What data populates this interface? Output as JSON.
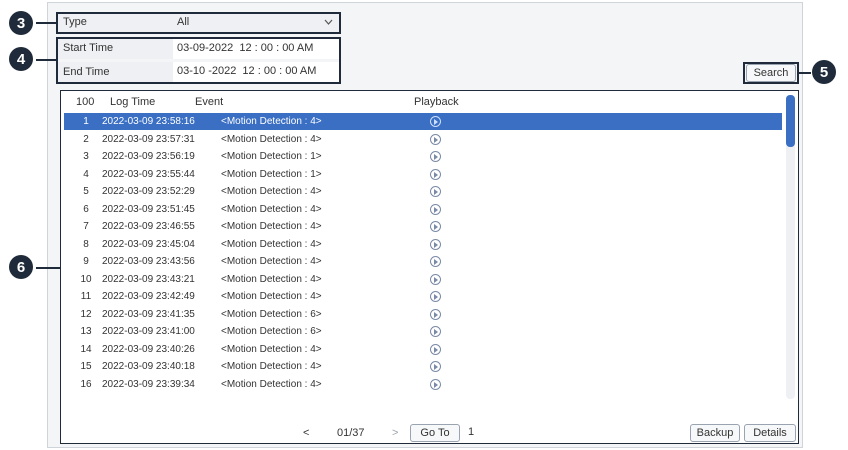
{
  "filters": {
    "type_label": "Type",
    "type_value": "All",
    "start_time_label": "Start Time",
    "start_time_value": "03-09-2022  12 : 00 : 00 AM",
    "end_time_label": "End Time",
    "end_time_value": "03-10 -2022  12 : 00 : 00 AM",
    "search_label": "Search"
  },
  "callouts": [
    "3",
    "4",
    "5",
    "6"
  ],
  "table": {
    "headers": {
      "count": "100",
      "log_time": "Log Time",
      "event": "Event",
      "playback": "Playback"
    },
    "rows": [
      {
        "num": "1",
        "time": "2022-03-09 23:58:16",
        "event": "<Motion Detection : 4>",
        "selected": true
      },
      {
        "num": "2",
        "time": "2022-03-09 23:57:31",
        "event": "<Motion Detection : 4>"
      },
      {
        "num": "3",
        "time": "2022-03-09 23:56:19",
        "event": "<Motion Detection : 1>"
      },
      {
        "num": "4",
        "time": "2022-03-09 23:55:44",
        "event": "<Motion Detection : 1>"
      },
      {
        "num": "5",
        "time": "2022-03-09 23:52:29",
        "event": "<Motion Detection : 4>"
      },
      {
        "num": "6",
        "time": "2022-03-09 23:51:45",
        "event": "<Motion Detection : 4>"
      },
      {
        "num": "7",
        "time": "2022-03-09 23:46:55",
        "event": "<Motion Detection : 4>"
      },
      {
        "num": "8",
        "time": "2022-03-09 23:45:04",
        "event": "<Motion Detection : 4>"
      },
      {
        "num": "9",
        "time": "2022-03-09 23:43:56",
        "event": "<Motion Detection : 4>"
      },
      {
        "num": "10",
        "time": "2022-03-09 23:43:21",
        "event": "<Motion Detection : 4>"
      },
      {
        "num": "11",
        "time": "2022-03-09 23:42:49",
        "event": "<Motion Detection : 4>"
      },
      {
        "num": "12",
        "time": "2022-03-09 23:41:35",
        "event": "<Motion Detection : 6>"
      },
      {
        "num": "13",
        "time": "2022-03-09 23:41:00",
        "event": "<Motion Detection : 6>"
      },
      {
        "num": "14",
        "time": "2022-03-09 23:40:26",
        "event": "<Motion Detection : 4>"
      },
      {
        "num": "15",
        "time": "2022-03-09 23:40:18",
        "event": "<Motion Detection : 4>"
      },
      {
        "num": "16",
        "time": "2022-03-09 23:39:34",
        "event": "<Motion Detection : 4>"
      }
    ]
  },
  "pager": {
    "prev": "<",
    "page": "01/37",
    "next": ">",
    "goto_label": "Go To",
    "page_input_value": "1"
  },
  "footer": {
    "backup_label": "Backup",
    "details_label": "Details"
  },
  "icons": {
    "dropdown": "chevron-down-icon",
    "playback": "play-circle-icon"
  },
  "colors": {
    "selection": "#3a6fc4",
    "callout": "#1f2a3a",
    "panel": "#f4f5f7"
  }
}
